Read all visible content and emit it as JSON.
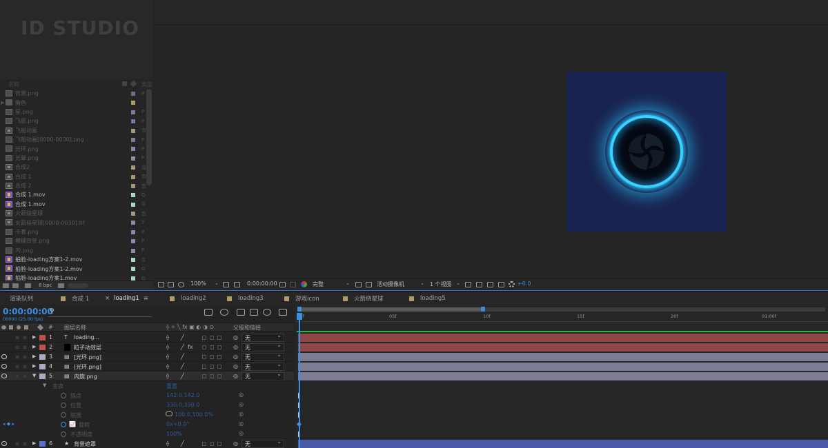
{
  "watermark": "ID STUDIO",
  "project": {
    "header": {
      "name_col": "名称",
      "type_col": "类型"
    },
    "items": [
      {
        "name": "背景.png",
        "icon": "file-icon",
        "swatch": "#6e6e8a",
        "type": "P"
      },
      {
        "name": "角色",
        "icon": "folder-icon",
        "swatch": "#b0a060",
        "type": "",
        "expandable": true
      },
      {
        "name": "星.png",
        "icon": "file-icon",
        "swatch": "#7a7aa0",
        "type": "P"
      },
      {
        "name": "飞船.png",
        "icon": "file-icon",
        "swatch": "#7a7aa0",
        "type": "P"
      },
      {
        "name": "飞船动画",
        "icon": "comp-icon",
        "swatch": "#a8987a",
        "type": "合"
      },
      {
        "name": "飞船动画[0000-0030].png",
        "icon": "file-icon",
        "swatch": "#7a7aa0",
        "type": "P"
      },
      {
        "name": "光环.png",
        "icon": "file-icon",
        "swatch": "#8a8aaa",
        "type": "P"
      },
      {
        "name": "光晕.png",
        "icon": "file-icon",
        "swatch": "#8a8aaa",
        "type": "P"
      },
      {
        "name": "合成2",
        "icon": "comp-icon",
        "swatch": "#a8987a",
        "type": "合"
      },
      {
        "name": "合成 1",
        "icon": "comp-icon",
        "swatch": "#a8987a",
        "type": "合"
      },
      {
        "name": "合成 2",
        "icon": "comp-icon",
        "swatch": "#a8987a",
        "type": "合"
      },
      {
        "name": "合成 1.mov",
        "icon": "video-icon",
        "swatch": "#a8d8c8",
        "type": "Q",
        "bright": true
      },
      {
        "name": "合成 1.mov",
        "icon": "video-icon",
        "swatch": "#a8d8c8",
        "type": "Q",
        "bright": true
      },
      {
        "name": "火箭绕星球",
        "icon": "comp-icon",
        "swatch": "#a8987a",
        "type": "合"
      },
      {
        "name": "火箭绕星球[0000-0030].tif",
        "icon": "comp-icon",
        "swatch": "#8a8aaa",
        "type": "T"
      },
      {
        "name": "卡套.png",
        "icon": "file-icon",
        "swatch": "#8a8aaa",
        "type": "P"
      },
      {
        "name": "模糊背景.png",
        "icon": "file-icon",
        "swatch": "#8a8aaa",
        "type": "P"
      },
      {
        "name": "内.png",
        "icon": "file-icon",
        "swatch": "#8a8aaa",
        "type": "P"
      },
      {
        "name": "拍脸-loading方案1-2.mov",
        "icon": "video-icon",
        "swatch": "#a8d8c8",
        "type": "Q",
        "bright": true
      },
      {
        "name": "拍脸-loading方案1-2.mov",
        "icon": "video-icon",
        "swatch": "#a8d8c8",
        "type": "Q",
        "bright": true
      },
      {
        "name": "拍脸-loading方案1.mov",
        "icon": "video-icon",
        "swatch": "#a8d8c8",
        "type": "Q",
        "bright": true
      }
    ],
    "footer": {
      "bpc": "8 bpc"
    }
  },
  "viewer": {
    "canvas_color": "#19234f",
    "ring_color": "#3ad0ff",
    "toolbar": {
      "zoom": "100%",
      "timecode": "0:00:00:00",
      "resolution": "完整",
      "camera": "活动摄像机",
      "views": "1 个视图",
      "exposure": "+0.0"
    }
  },
  "tabs": [
    {
      "label": "渲染队列",
      "swatch": ""
    },
    {
      "label": "合成 1",
      "swatch": "#b49b6a"
    },
    {
      "label": "loading1",
      "swatch": "",
      "active": true
    },
    {
      "label": "loading2",
      "swatch": "#b49b6a"
    },
    {
      "label": "loading3",
      "swatch": "#b49b6a"
    },
    {
      "label": "游戏icon",
      "swatch": "#b49b6a"
    },
    {
      "label": "火箭绕星球",
      "swatch": "#b49b6a"
    },
    {
      "label": "loading5",
      "swatch": "#b49b6a"
    }
  ],
  "timeline": {
    "timecode": "0:00:00:00",
    "fps": "00000 (25.00 fps)",
    "search_placeholder": "",
    "columns": {
      "num": "#",
      "layer_name": "图层名称",
      "parent": "父级和链接"
    },
    "layers": [
      {
        "num": "1",
        "name": "loading...",
        "icon": "text-layer-icon",
        "color": "#c0504d",
        "bar_color": "#8e4646",
        "parent": "无",
        "eye": false
      },
      {
        "num": "2",
        "name": "粒子动效层",
        "icon": "solid-layer-icon",
        "color": "#c0504d",
        "bar_color": "#8e4646",
        "parent": "无",
        "eye": false
      },
      {
        "num": "3",
        "name": "[光环.png]",
        "icon": "footage-icon",
        "color": "#a9a9c4",
        "bar_color": "#7c7c96",
        "parent": "无",
        "eye": true
      },
      {
        "num": "4",
        "name": "[光环.png]",
        "icon": "footage-icon",
        "color": "#a9a9c4",
        "bar_color": "#7c7c96",
        "parent": "无",
        "eye": true
      },
      {
        "num": "5",
        "name": "内旋.png",
        "icon": "footage-icon",
        "color": "#a9a9c4",
        "bar_color": "#7c7c96",
        "parent": "无",
        "eye": true,
        "expanded": true
      },
      {
        "num": "6",
        "name": "背景遮罩",
        "icon": "star-layer-icon",
        "color": "#5b6fd0",
        "bar_color": "#4a58a8",
        "parent": "无",
        "eye": true
      }
    ],
    "transform": {
      "label": "变换",
      "reset": "重置",
      "properties": [
        {
          "name": "锚点",
          "value": "142.0,142.0"
        },
        {
          "name": "位置",
          "value": "330.0,330.0"
        },
        {
          "name": "缩放",
          "value": "100.0,100.0%"
        },
        {
          "name": "旋转",
          "value": "0x+0.0°",
          "keyframed": true
        },
        {
          "name": "不透明度",
          "value": "100%"
        }
      ]
    },
    "ruler": [
      "0f",
      "05f",
      "10f",
      "15f",
      "20f",
      "01:00f"
    ]
  }
}
